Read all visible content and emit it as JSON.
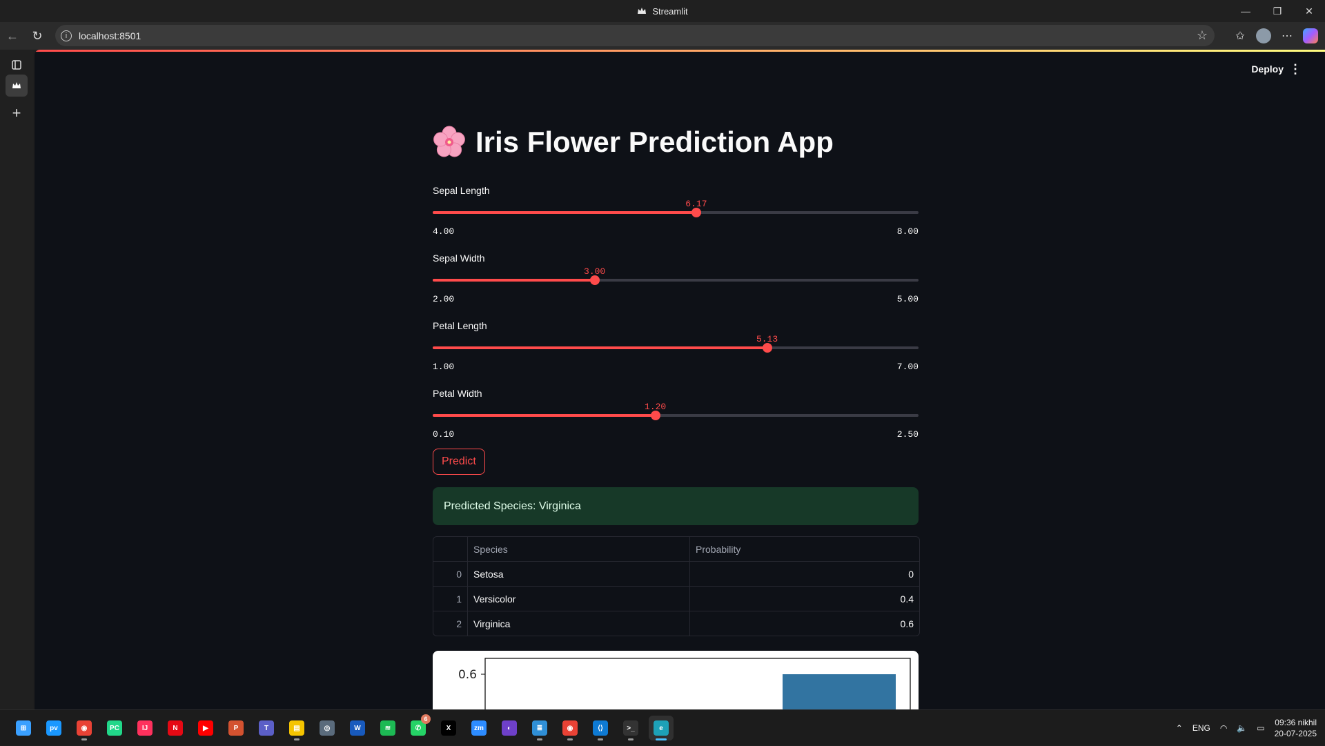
{
  "window": {
    "title": "Streamlit"
  },
  "browser": {
    "url": "localhost:8501"
  },
  "header": {
    "deploy_label": "Deploy"
  },
  "app": {
    "title": "Iris Flower Prediction App",
    "sliders": [
      {
        "label": "Sepal Length",
        "value": "6.17",
        "min": "4.00",
        "max": "8.00",
        "fraction": 0.5425
      },
      {
        "label": "Sepal Width",
        "value": "3.00",
        "min": "2.00",
        "max": "5.00",
        "fraction": 0.3333
      },
      {
        "label": "Petal Length",
        "value": "5.13",
        "min": "1.00",
        "max": "7.00",
        "fraction": 0.6883
      },
      {
        "label": "Petal Width",
        "value": "1.20",
        "min": "0.10",
        "max": "2.50",
        "fraction": 0.4583
      }
    ],
    "predict_label": "Predict",
    "result_text": "Predicted Species: Virginica",
    "table": {
      "headers": [
        "",
        "Species",
        "Probability"
      ],
      "rows": [
        {
          "index": "0",
          "species": "Setosa",
          "probability": "0"
        },
        {
          "index": "1",
          "species": "Versicolor",
          "probability": "0.4"
        },
        {
          "index": "2",
          "species": "Virginica",
          "probability": "0.6"
        }
      ]
    },
    "chart": {
      "visible_tick": "0.6"
    }
  },
  "colors": {
    "accent": "#ff4b4b",
    "background": "#0e1117",
    "success_bg": "#173928",
    "bar": "#3274a1"
  },
  "taskbar": {
    "apps": [
      "windows-start",
      "prime-video",
      "chrome",
      "pycharm",
      "intellij",
      "netflix",
      "youtube",
      "powerpoint",
      "teams",
      "file-explorer",
      "camera",
      "word",
      "spotify",
      "whatsapp",
      "x",
      "zoom",
      "github-desktop",
      "notepad",
      "chrome",
      "vscode",
      "terminal",
      "edge"
    ],
    "whatsapp_badge": "6",
    "language": "ENG",
    "time": "09:36 nikhil",
    "date": "20-07-2025"
  }
}
